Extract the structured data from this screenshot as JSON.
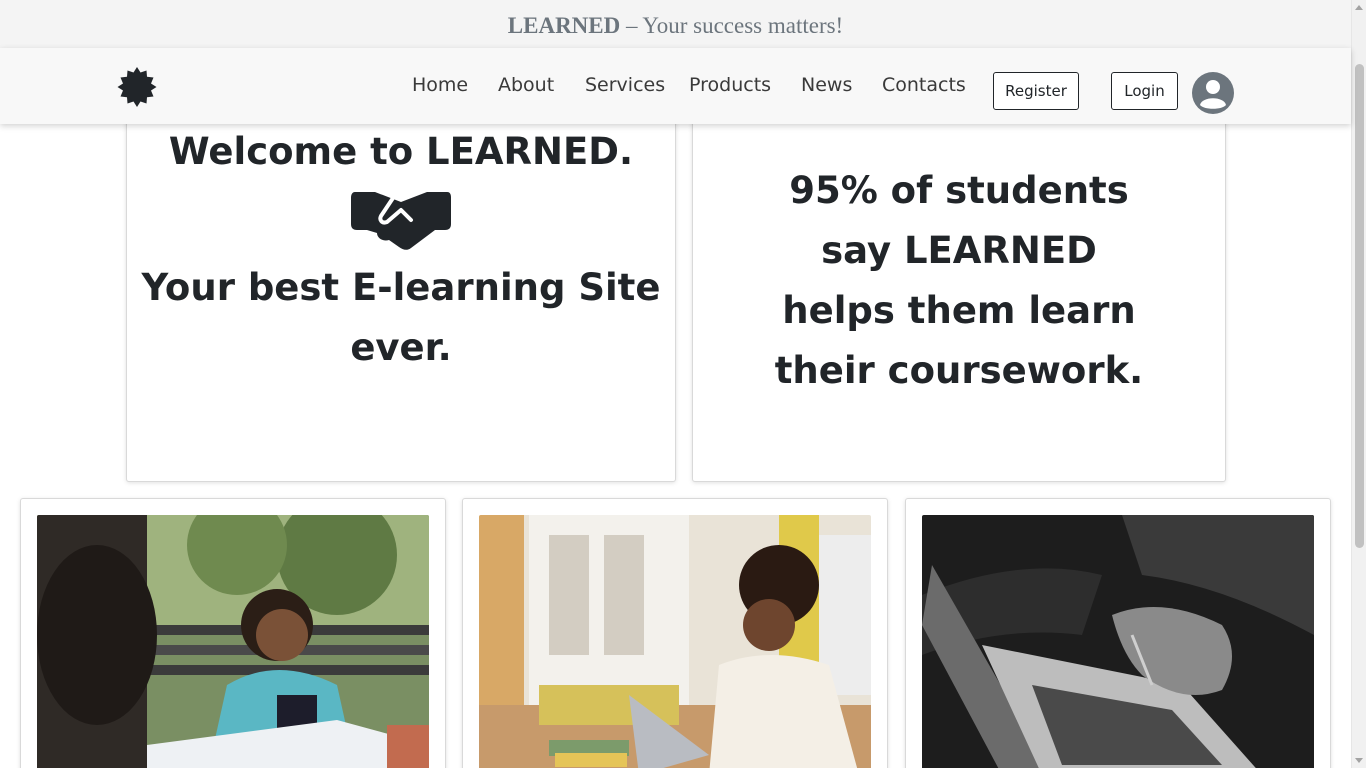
{
  "topbar": {
    "brand": "LEARNED",
    "separator": "–",
    "tagline": "Your success matters!"
  },
  "nav": {
    "logo_icon": "badge-icon",
    "links": [
      "Home",
      "About",
      "Services",
      "Products",
      "News",
      "Contacts"
    ],
    "register_label": "Register",
    "login_label": "Login",
    "avatar_icon": "user-avatar-icon"
  },
  "welcome": {
    "heading": "Welcome to LEARNED.",
    "icon": "handshake-icon",
    "subheading": "Your best E-learning Site ever."
  },
  "stats": {
    "text": "95% of students say LEARNED helps them learn their coursework."
  },
  "photos": [
    {
      "name": "students-studying-outdoors"
    },
    {
      "name": "student-on-laptop"
    },
    {
      "name": "hands-typing-laptop"
    }
  ],
  "colors": {
    "topbar_bg": "#f4f4f4",
    "navbar_bg": "#f8f8f8",
    "text_dark": "#212529",
    "muted": "#6c757d"
  }
}
